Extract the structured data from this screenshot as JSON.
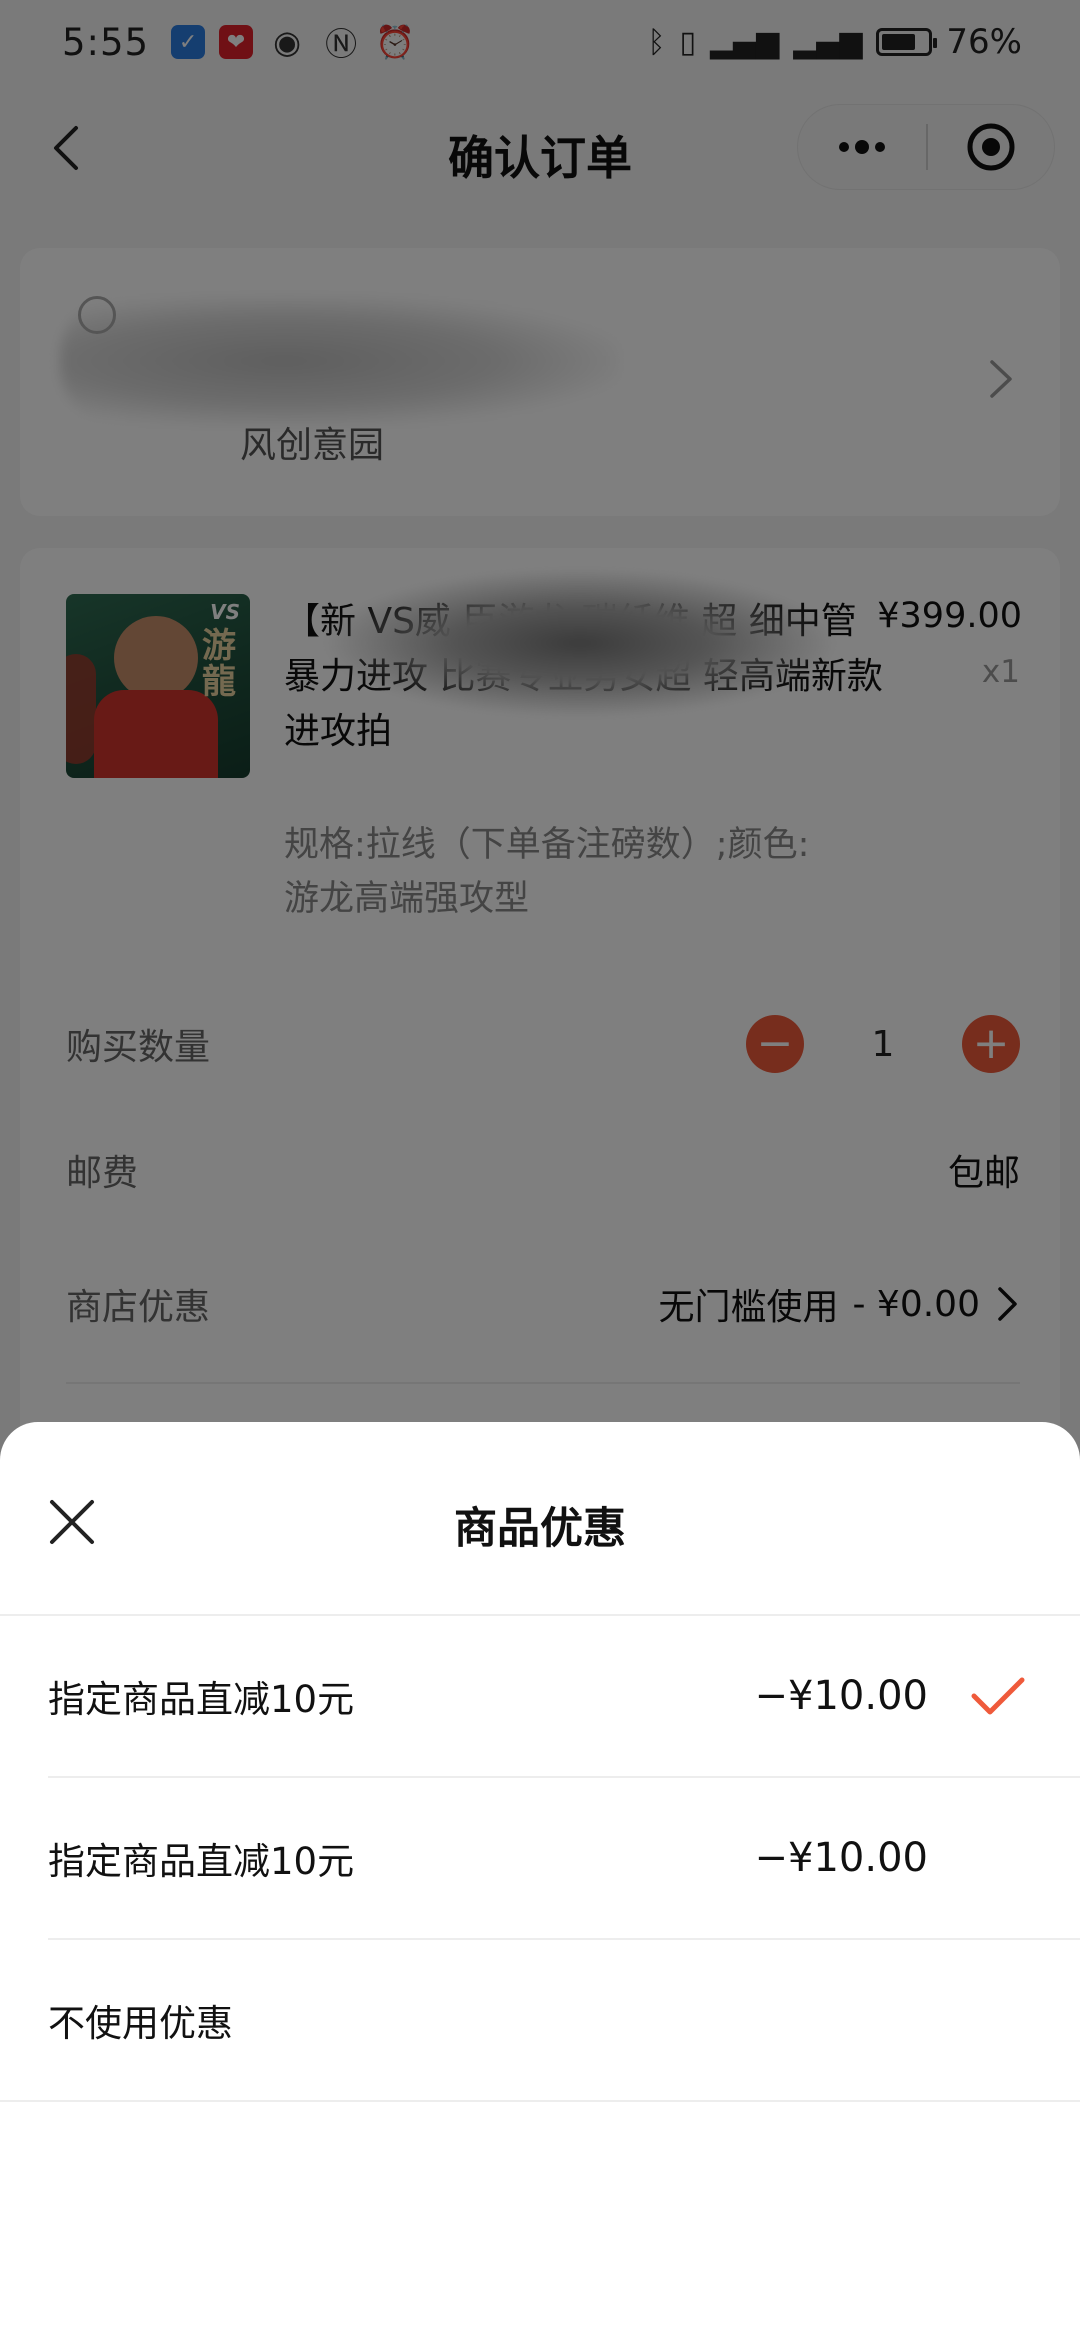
{
  "status_bar": {
    "time": "5:55",
    "battery_level": 0.76,
    "battery_text": "76%",
    "network": "4G"
  },
  "nav": {
    "title": "确认订单"
  },
  "address": {
    "text": "风创意园"
  },
  "product": {
    "title": "【新  VS威 臣游龙  碳纤维 超 细中管 暴力进攻 比赛专业男女超 轻高端新款进攻拍",
    "spec": "规格:拉线（下单备注磅数）;颜色:游龙高端强攻型",
    "price": "¥399.00",
    "quantity": "x1",
    "thumb_logo": "VS",
    "thumb_title": "游龍"
  },
  "rows": {
    "purchase_qty_label": "购买数量",
    "purchase_qty_value": "1",
    "minus": "−",
    "plus": "+",
    "shipping_label": "邮费",
    "shipping_value": "包邮",
    "store_discount_label": "商店优惠",
    "store_discount_condition": "无门槛使用",
    "store_discount_value": "- ¥0.00"
  },
  "sheet": {
    "title": "商品优惠",
    "options": [
      {
        "label": "指定商品直减10元",
        "amount": "−¥10.00",
        "selected": true
      },
      {
        "label": "指定商品直减10元",
        "amount": "−¥10.00",
        "selected": false
      },
      {
        "label": "不使用优惠",
        "amount": "",
        "selected": false
      }
    ]
  },
  "colors": {
    "accent": "#ef5a3b",
    "overlay": "rgba(0,0,0,0.5)"
  }
}
